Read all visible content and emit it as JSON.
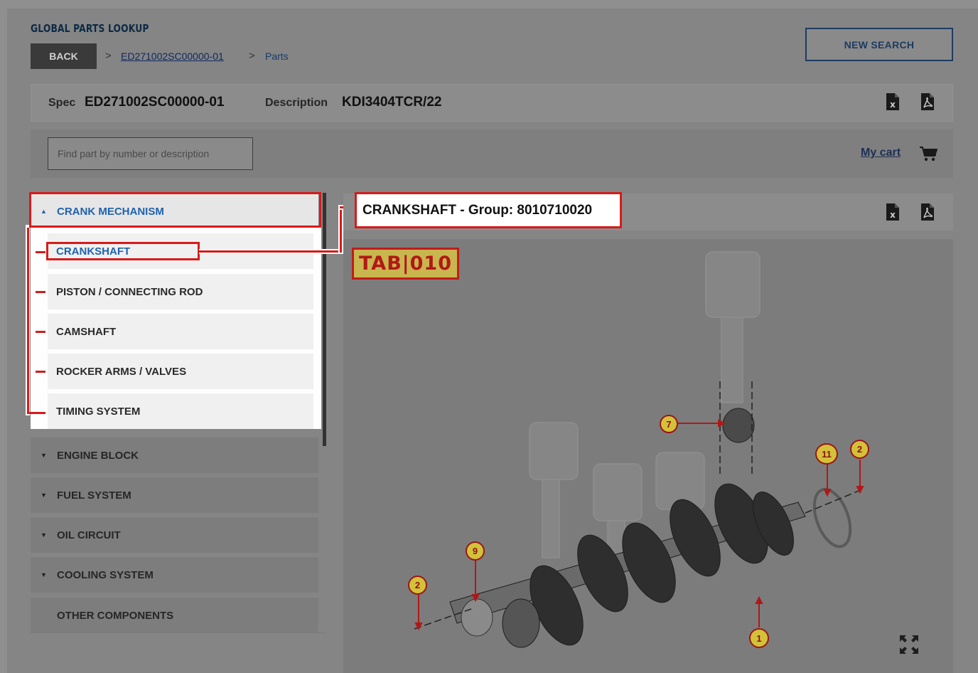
{
  "header": {
    "app_title": "GLOBAL PARTS LOOKUP",
    "back_label": "BACK",
    "breadcrumb": {
      "separator": ">",
      "spec_link": "ED271002SC00000-01",
      "current": "Parts"
    },
    "new_search_label": "NEW SEARCH"
  },
  "spec": {
    "spec_label": "Spec",
    "spec_value": "ED271002SC00000-01",
    "description_label": "Description",
    "description_value": "KDI3404TCR/22"
  },
  "search": {
    "placeholder": "Find part by number or description",
    "cart_label": "My cart"
  },
  "nav": {
    "categories": [
      {
        "label": "CRANK MECHANISM",
        "expanded": true
      },
      {
        "label": "ENGINE BLOCK",
        "expanded": false
      },
      {
        "label": "FUEL SYSTEM",
        "expanded": false
      },
      {
        "label": "OIL CIRCUIT",
        "expanded": false
      },
      {
        "label": "COOLING SYSTEM",
        "expanded": false
      },
      {
        "label": "OTHER COMPONENTS",
        "expanded": false
      }
    ],
    "subitems": [
      {
        "label": "CRANKSHAFT",
        "active": true
      },
      {
        "label": "PISTON / CONNECTING ROD",
        "active": false
      },
      {
        "label": "CAMSHAFT",
        "active": false
      },
      {
        "label": "ROCKER ARMS / VALVES",
        "active": false
      },
      {
        "label": "TIMING SYSTEM",
        "active": false
      }
    ]
  },
  "group": {
    "title": "CRANKSHAFT - Group: 8010710020"
  },
  "diagram": {
    "tab_label": "TAB|010",
    "callouts": [
      "7",
      "11",
      "2",
      "9",
      "2",
      "1"
    ]
  },
  "colors": {
    "accent_blue": "#1f62ad",
    "highlight_red": "#d81a1a",
    "navy": "#1d3b62",
    "callout_yellow": "#d4c13a"
  }
}
